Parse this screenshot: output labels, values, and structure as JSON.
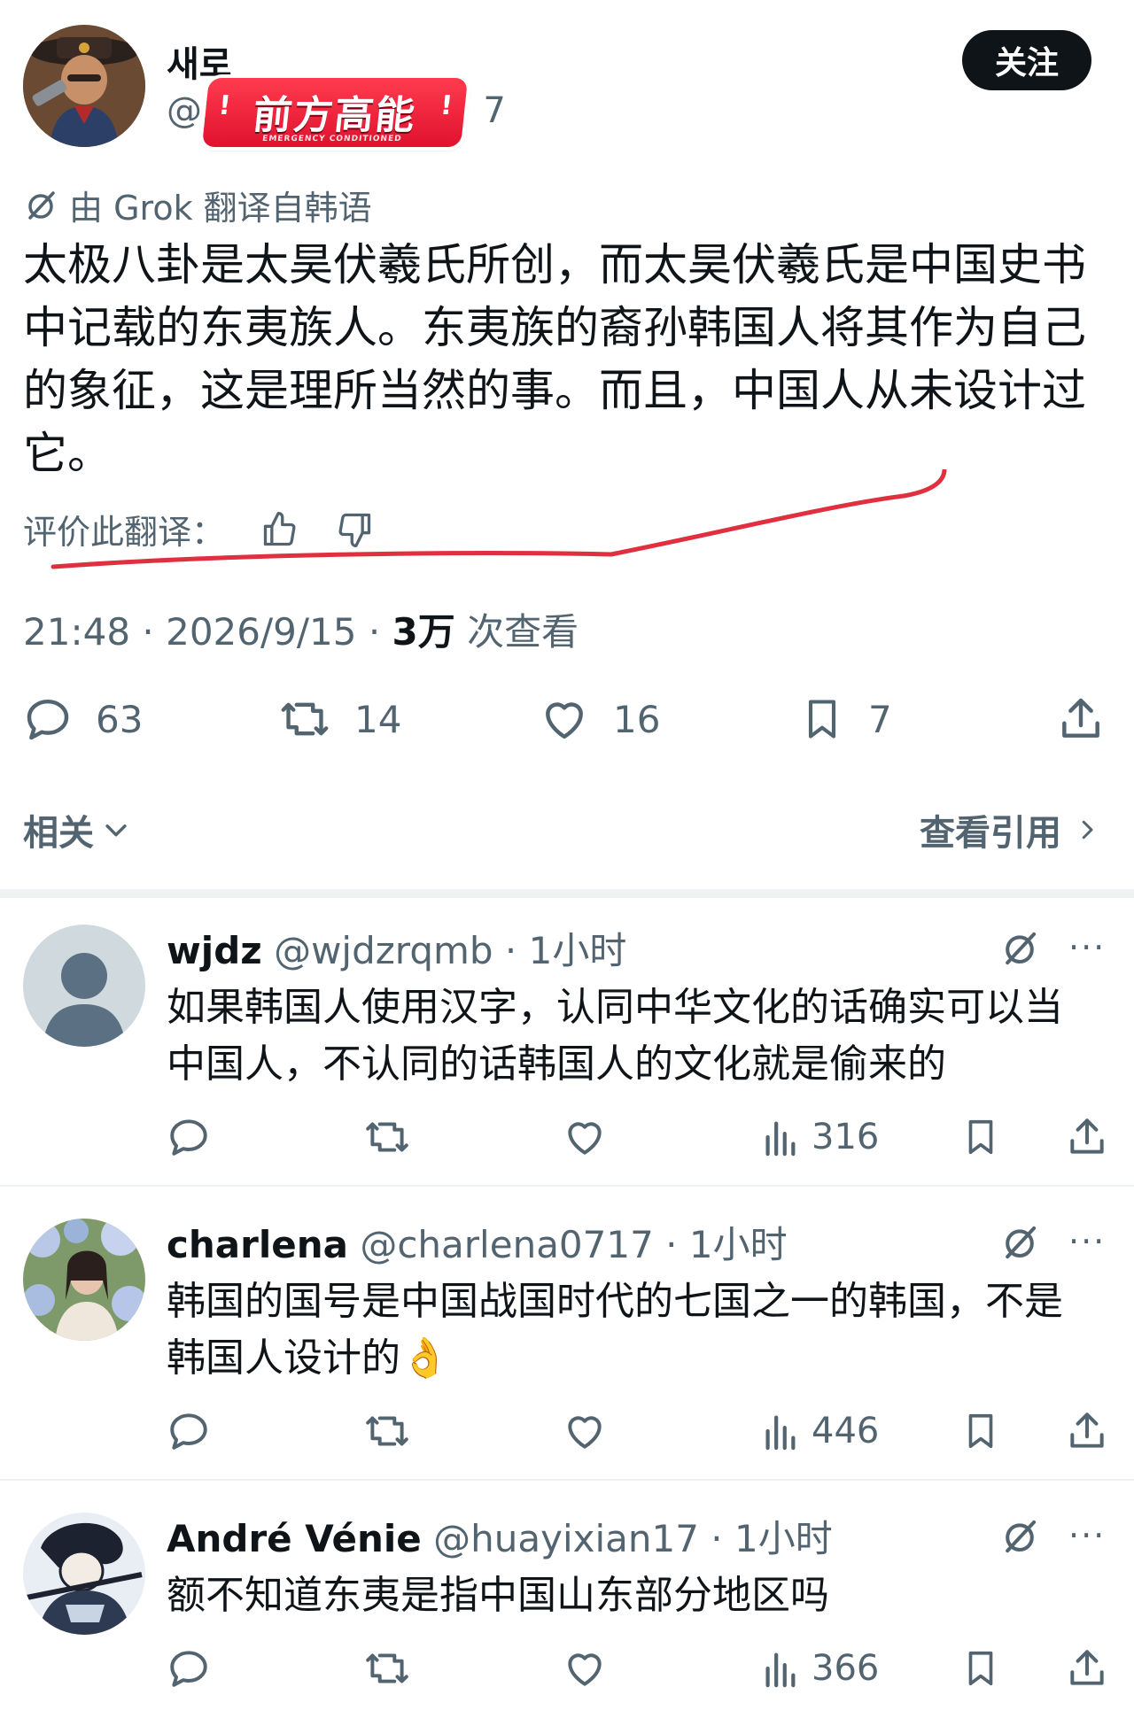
{
  "main_tweet": {
    "display_name": "새로",
    "handle": "@S",
    "handle_tail": "7",
    "sticker": {
      "text": "前方高能",
      "subtitle": "EMERGENCY CONDITIONED"
    },
    "follow_label": "关注",
    "translated_label": "由 Grok 翻译自韩语",
    "text": "太极八卦是太昊伏羲氏所创，而太昊伏羲氏是中国史书中记载的东夷族人。东夷族的裔孙韩国人将其作为自己的象征，这是理所当然的事。而且，中国人从未设计过它。",
    "rate_label": "评价此翻译：",
    "meta": {
      "time": "21:48",
      "date": "2026/9/15",
      "views": "3万",
      "views_label": "次查看",
      "sep": " · "
    },
    "stats": {
      "replies": "63",
      "reposts": "14",
      "likes": "16",
      "bookmarks": "7"
    },
    "related_label": "相关",
    "quotes_label": "查看引用"
  },
  "replies": [
    {
      "name": "wjdz",
      "handle": "@wjdzrqmb",
      "time": "1小时",
      "text": "如果韩国人使用汉字，认同中华文化的话确实可以当中国人，不认同的话韩国人的文化就是偷来的",
      "views": "316"
    },
    {
      "name": "charlena",
      "handle": "@charlena0717",
      "time": "1小时",
      "text": "韩国的国号是中国战国时代的七国之一的韩国，不是韩国人设计的👌",
      "views": "446"
    },
    {
      "name": "André Vénie",
      "handle": "@huayixian17",
      "time": "1小时",
      "text": "额不知道东夷是指中国山东部分地区吗",
      "views": "366"
    }
  ],
  "colors": {
    "text_primary": "#0f1419",
    "text_secondary": "#536471",
    "divider": "#eff3f4",
    "sticker_red": "#e0122e",
    "scribble_red": "#e0303f"
  }
}
